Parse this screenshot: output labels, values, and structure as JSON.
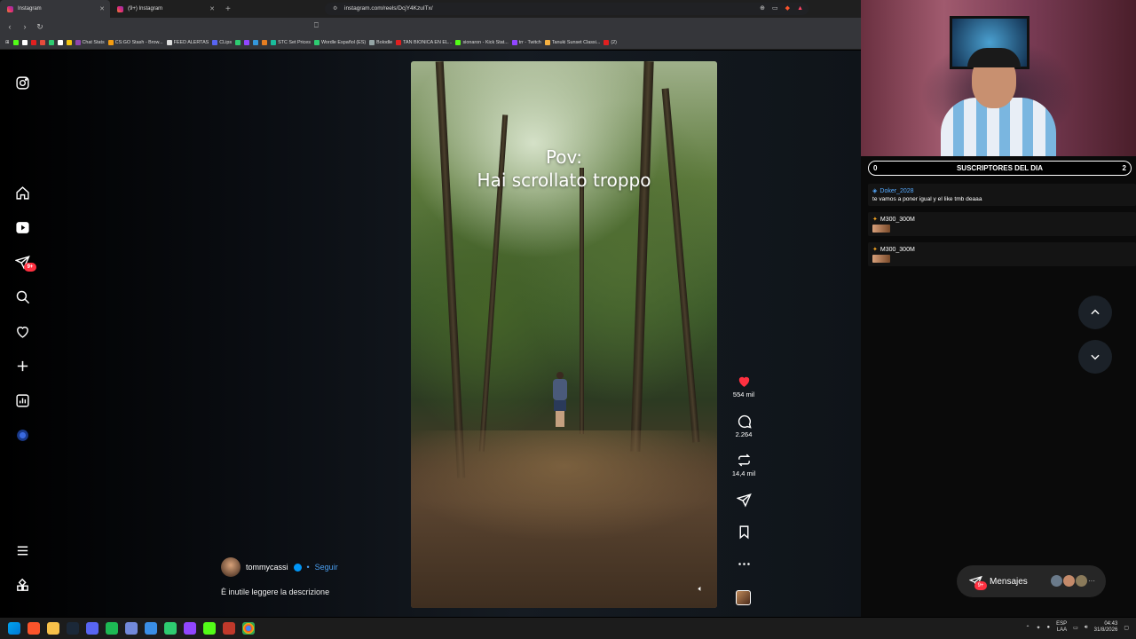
{
  "browser": {
    "tabs": [
      {
        "label": "Instagram",
        "active": true
      },
      {
        "label": "(9+) Instagram",
        "active": false
      }
    ],
    "url": "instagram.com/reels/DcjY4KzuITx/",
    "bookmarks": [
      "Chat Stats",
      "CS:GO Stash - Brow...",
      "FEED ALERTAS",
      "CLips",
      "STC Set Prices",
      "Wordle Español (ES)",
      "Bolodle",
      "TAN BIONICA EN EL...",
      "sionaron - Kick Stat...",
      "trr - Twitch",
      "Tanuki Sunset Classi...",
      "(2)"
    ]
  },
  "sidebar": {
    "notifications_badge": "9+",
    "icons": [
      "instagram-logo",
      "home",
      "reels",
      "messages",
      "search",
      "notifications",
      "create",
      "dashboard",
      "profile",
      "more",
      "meta-apps"
    ]
  },
  "reel": {
    "overlay_line1": "Pov:",
    "overlay_line2": "Hai scrollato troppo",
    "likes": "554 mil",
    "comments": "2.264",
    "reposts": "14,4 mil",
    "author": "tommycassi",
    "follow_label": "Seguir",
    "description": "È inutile leggere la descrizione"
  },
  "stream": {
    "subs_label": "SUSCRIPTORES DEL DIA",
    "subs_left": "0",
    "subs_right": "2",
    "chat": [
      {
        "user": "Doker_2028",
        "message": "te vamos a poner igual y el like tmb deaaa"
      },
      {
        "user": "M300_300M",
        "message": ""
      },
      {
        "user": "M300_300M",
        "message": ""
      }
    ],
    "messages_label": "Mensajes",
    "messages_badge": "9+"
  },
  "taskbar": {
    "lang_line1": "ESP",
    "lang_line2": "LAA",
    "time": "04:43",
    "date": "31/8/2026"
  },
  "colors": {
    "like_red": "#ff3040",
    "instagram_blue": "#0095f6"
  }
}
